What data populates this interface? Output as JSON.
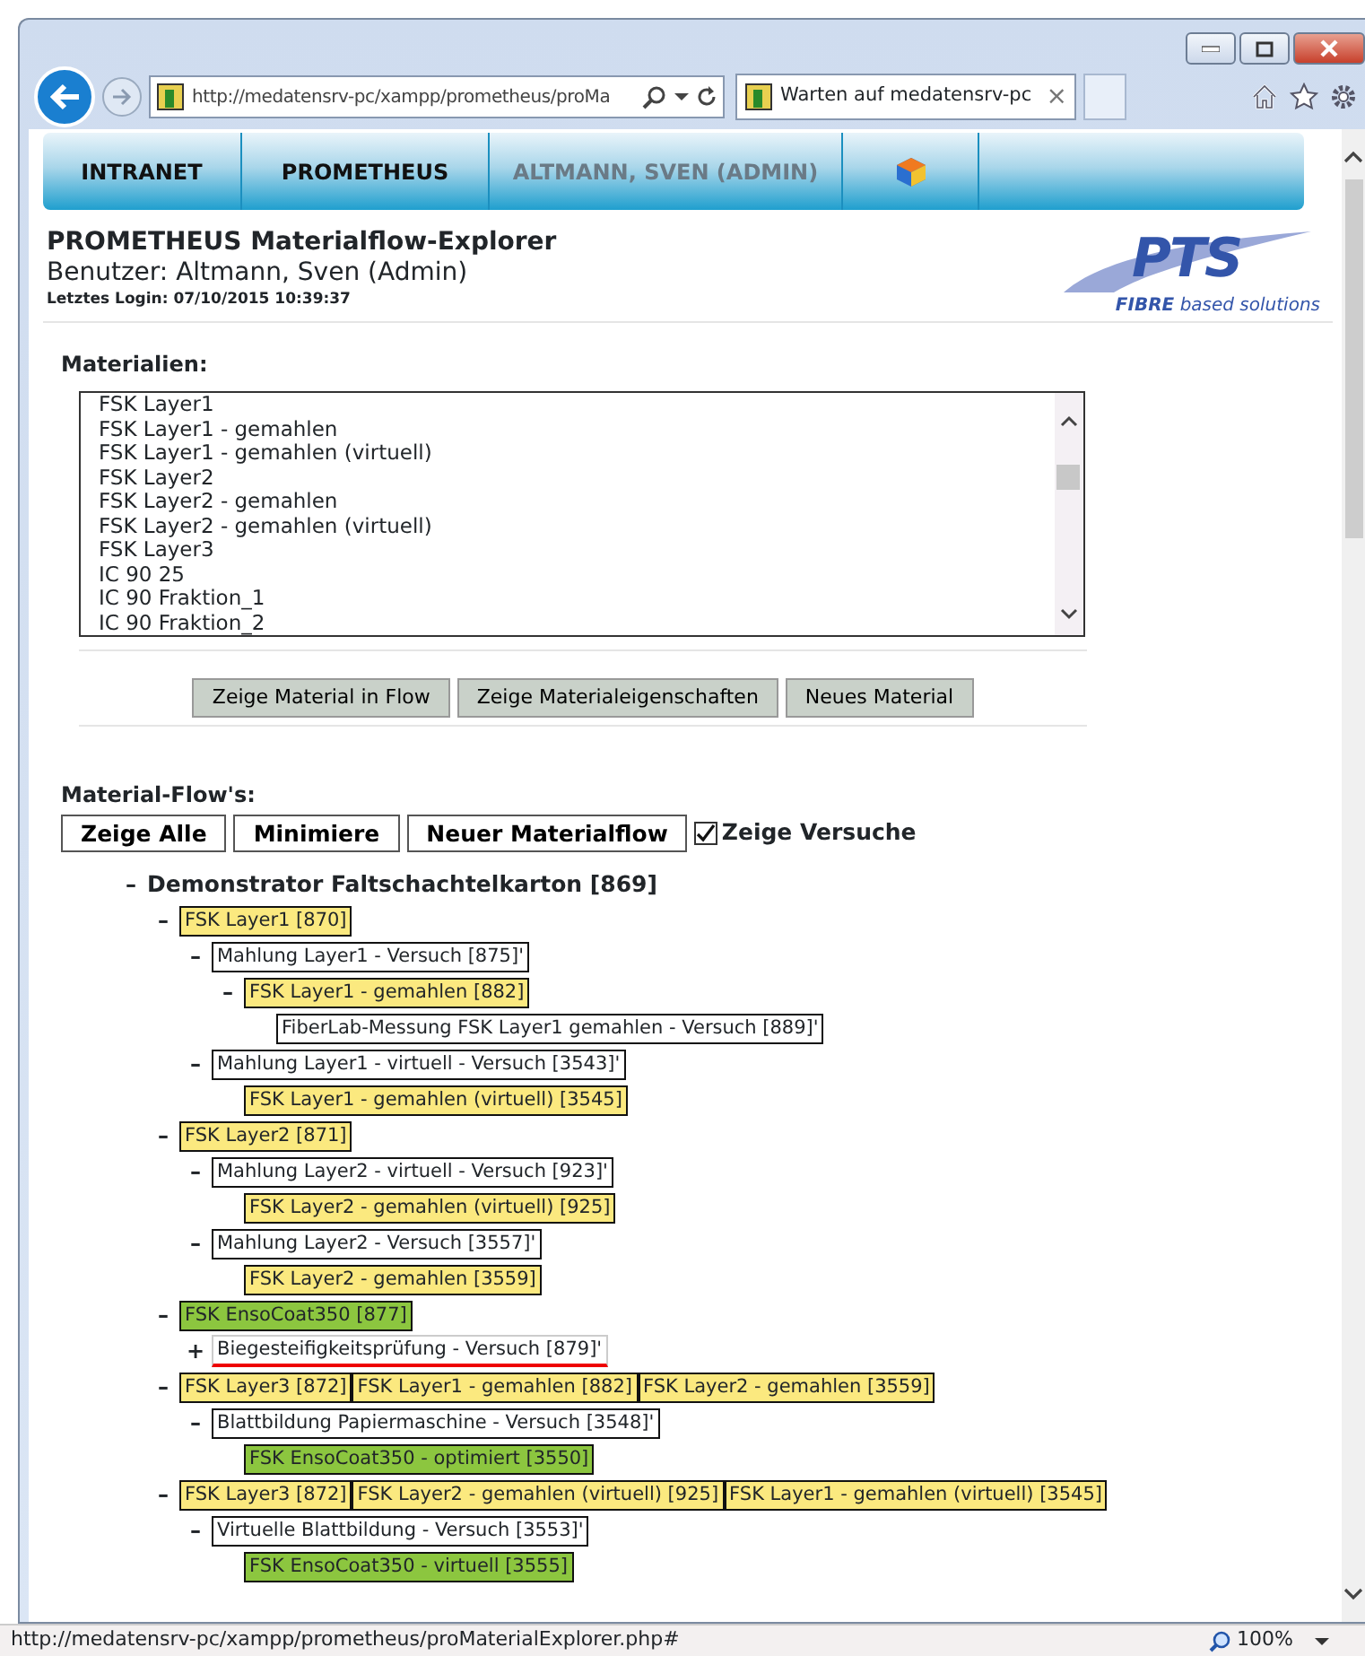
{
  "browser": {
    "address": "http://medatensrv-pc/xampp/prometheus/proMa",
    "tab": {
      "title": "Warten auf medatensrv-pc",
      "close": "×"
    }
  },
  "nav": [
    {
      "label": "INTRANET",
      "disabled": false
    },
    {
      "label": "PROMETHEUS",
      "disabled": false
    },
    {
      "label": "ALTMANN, SVEN (ADMIN)",
      "disabled": true
    }
  ],
  "header": {
    "title": "PROMETHEUS Materialflow-Explorer",
    "user": "Benutzer: Altmann, Sven (Admin)",
    "last_login": "Letztes Login: 07/10/2015 10:39:37"
  },
  "logo": {
    "name": "PTS",
    "tagline": "**FIBRE** based solutions"
  },
  "materials": {
    "label": "Materialien:",
    "items": [
      "FSK Layer1",
      "FSK Layer1 - gemahlen",
      "FSK Layer1 - gemahlen (virtuell)",
      "FSK Layer2",
      "FSK Layer2 - gemahlen",
      "FSK Layer2 - gemahlen (virtuell)",
      "FSK Layer3",
      "IC 90 25",
      "IC 90 Fraktion_1",
      "IC 90 Fraktion_2"
    ],
    "buttons": [
      "Zeige Material in Flow",
      "Zeige Materialeigenschaften",
      "Neues Material"
    ]
  },
  "flows": {
    "label": "Material-Flow's:",
    "buttons": [
      "Zeige Alle",
      "Minimiere",
      "Neuer Materialflow"
    ],
    "checkbox": {
      "label": "Zeige Versuche",
      "checked": true
    }
  },
  "tree": {
    "toggle": "–",
    "title": "Demonstrator Faltschachtelkarton [869]",
    "children": [
      {
        "toggle": "–",
        "boxes": [
          {
            "kind": "material",
            "color": "#fbe97f",
            "label": "FSK Layer1 [870]"
          }
        ],
        "children": [
          {
            "toggle": "–",
            "boxes": [
              {
                "kind": "process",
                "label": "Mahlung Layer1 - Versuch [875]'"
              }
            ],
            "children": [
              {
                "toggle": "–",
                "boxes": [
                  {
                    "kind": "material",
                    "color": "#fbe97f",
                    "label": "FSK Layer1 - gemahlen [882]"
                  }
                ],
                "children": [
                  {
                    "boxes": [
                      {
                        "kind": "process",
                        "label": "FiberLab-Messung FSK Layer1 gemahlen - Versuch [889]'"
                      }
                    ]
                  }
                ]
              }
            ]
          },
          {
            "toggle": "–",
            "boxes": [
              {
                "kind": "process",
                "label": "Mahlung Layer1 - virtuell - Versuch [3543]'"
              }
            ],
            "children": [
              {
                "boxes": [
                  {
                    "kind": "material",
                    "color": "#fbe97f",
                    "label": "FSK Layer1 - gemahlen (virtuell) [3545]"
                  }
                ]
              }
            ]
          }
        ]
      },
      {
        "toggle": "–",
        "boxes": [
          {
            "kind": "material",
            "color": "#fbe97f",
            "label": "FSK Layer2 [871]"
          }
        ],
        "children": [
          {
            "toggle": "–",
            "boxes": [
              {
                "kind": "process",
                "label": "Mahlung Layer2 - virtuell - Versuch [923]'"
              }
            ],
            "children": [
              {
                "boxes": [
                  {
                    "kind": "material",
                    "color": "#fbe97f",
                    "label": "FSK Layer2 - gemahlen (virtuell) [925]"
                  }
                ]
              }
            ]
          },
          {
            "toggle": "–",
            "boxes": [
              {
                "kind": "process",
                "label": "Mahlung Layer2 - Versuch [3557]'"
              }
            ],
            "children": [
              {
                "boxes": [
                  {
                    "kind": "material",
                    "color": "#fbe97f",
                    "label": "FSK Layer2 - gemahlen [3559]"
                  }
                ]
              }
            ]
          }
        ]
      },
      {
        "toggle": "–",
        "boxes": [
          {
            "kind": "material",
            "color": "#8cc63f",
            "label": "FSK EnsoCoat350 [877]"
          }
        ],
        "children": [
          {
            "toggle": "+",
            "boxes": [
              {
                "kind": "flagged",
                "label": "Biegesteifigkeitsprüfung - Versuch [879]'"
              }
            ]
          }
        ]
      },
      {
        "toggle": "–",
        "boxes": [
          {
            "kind": "material",
            "color": "#fbe97f",
            "label": "FSK Layer3 [872]"
          },
          {
            "kind": "material",
            "color": "#fbe97f",
            "label": "FSK Layer1 - gemahlen [882]"
          },
          {
            "kind": "material",
            "color": "#fbe97f",
            "label": "FSK Layer2 - gemahlen [3559]"
          }
        ],
        "children": [
          {
            "toggle": "–",
            "boxes": [
              {
                "kind": "process",
                "label": "Blattbildung Papiermaschine - Versuch [3548]'"
              }
            ],
            "children": [
              {
                "boxes": [
                  {
                    "kind": "material",
                    "color": "#8cc63f",
                    "label": "FSK EnsoCoat350 - optimiert [3550]"
                  }
                ]
              }
            ]
          }
        ]
      },
      {
        "toggle": "–",
        "boxes": [
          {
            "kind": "material",
            "color": "#fbe97f",
            "label": "FSK Layer3 [872]"
          },
          {
            "kind": "material",
            "color": "#fbe97f",
            "label": "FSK Layer2 - gemahlen (virtuell) [925]"
          },
          {
            "kind": "material",
            "color": "#fbe97f",
            "label": "FSK Layer1 - gemahlen (virtuell) [3545]"
          }
        ],
        "children": [
          {
            "toggle": "–",
            "boxes": [
              {
                "kind": "process",
                "label": "Virtuelle Blattbildung - Versuch [3553]'"
              }
            ],
            "children": [
              {
                "boxes": [
                  {
                    "kind": "material",
                    "color": "#8cc63f",
                    "label": "FSK EnsoCoat350 - virtuell [3555]"
                  }
                ]
              }
            ]
          }
        ]
      }
    ]
  },
  "status_bar": {
    "url": "http://medatensrv-pc/xampp/prometheus/proMaterialExplorer.php#",
    "zoom": "100%"
  }
}
